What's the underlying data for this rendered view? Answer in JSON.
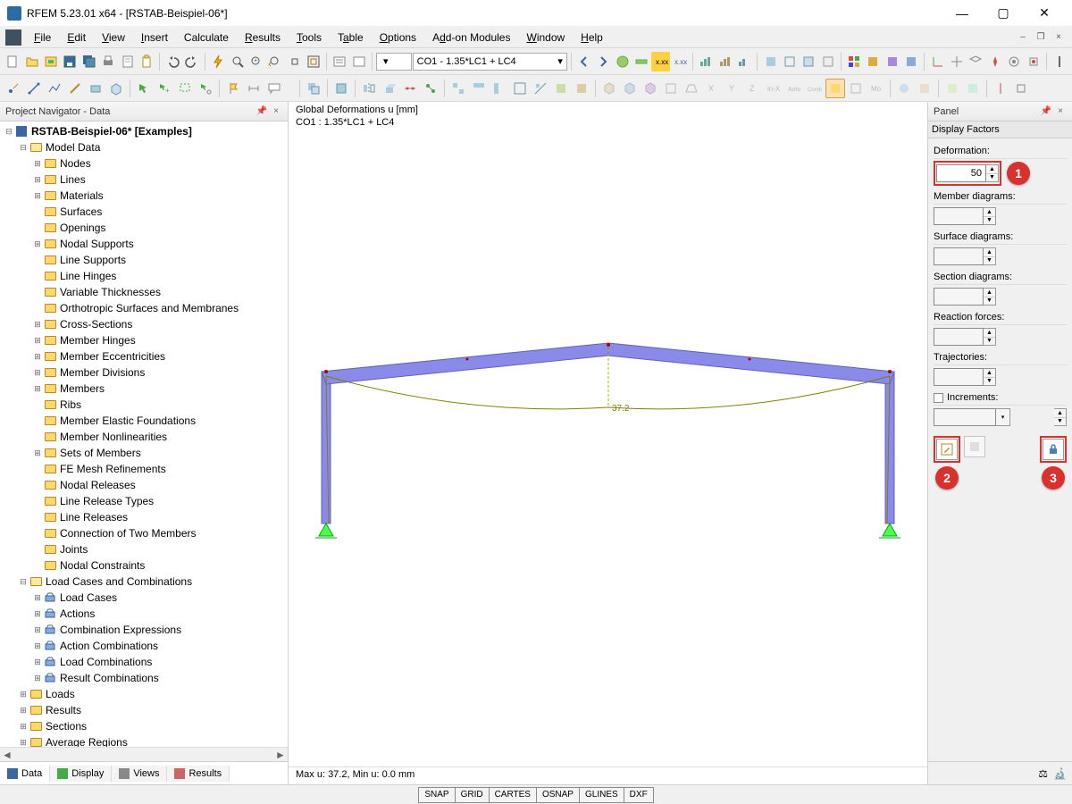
{
  "window": {
    "title": "RFEM 5.23.01 x64 - [RSTAB-Beispiel-06*]",
    "min": "—",
    "max": "▢",
    "close": "✕",
    "sub_min": "–",
    "sub_max": "❐",
    "sub_close": "×"
  },
  "menu": [
    "File",
    "Edit",
    "View",
    "Insert",
    "Calculate",
    "Results",
    "Tools",
    "Table",
    "Options",
    "Add-on Modules",
    "Window",
    "Help"
  ],
  "load_combo": "CO1 - 1.35*LC1 + LC4",
  "nav_title": "Project Navigator - Data",
  "tree": {
    "root": "RSTAB-Beispiel-06* [Examples]",
    "model_data": "Model Data",
    "model_items": [
      "Nodes",
      "Lines",
      "Materials",
      "Surfaces",
      "Openings",
      "Nodal Supports",
      "Line Supports",
      "Line Hinges",
      "Variable Thicknesses",
      "Orthotropic Surfaces and Membranes",
      "Cross-Sections",
      "Member Hinges",
      "Member Eccentricities",
      "Member Divisions",
      "Members",
      "Ribs",
      "Member Elastic Foundations",
      "Member Nonlinearities",
      "Sets of Members",
      "FE Mesh Refinements",
      "Nodal Releases",
      "Line Release Types",
      "Line Releases",
      "Connection of Two Members",
      "Joints",
      "Nodal Constraints"
    ],
    "lcc": "Load Cases and Combinations",
    "lcc_items": [
      "Load Cases",
      "Actions",
      "Combination Expressions",
      "Action Combinations",
      "Load Combinations",
      "Result Combinations"
    ],
    "tail": [
      "Loads",
      "Results",
      "Sections",
      "Average Regions"
    ]
  },
  "nav_tabs": [
    "Data",
    "Display",
    "Views",
    "Results"
  ],
  "viewport": {
    "title_line1": "Global Deformations u [mm]",
    "title_line2": "CO1 : 1.35*LC1 + LC4",
    "value_label": "37.2",
    "footer": "Max u: 37.2, Min u: 0.0 mm"
  },
  "panel": {
    "title": "Panel",
    "section_header": "Display Factors",
    "items": {
      "deformation": {
        "label": "Deformation:",
        "value": "50"
      },
      "member": {
        "label": "Member diagrams:",
        "value": ""
      },
      "surface": {
        "label": "Surface diagrams:",
        "value": ""
      },
      "section": {
        "label": "Section diagrams:",
        "value": ""
      },
      "reaction": {
        "label": "Reaction forces:",
        "value": ""
      },
      "traj": {
        "label": "Trajectories:",
        "value": ""
      },
      "incr": {
        "label": "Increments:",
        "value": ""
      }
    },
    "callouts": {
      "c1": "1",
      "c2": "2",
      "c3": "3"
    }
  },
  "status": [
    "SNAP",
    "GRID",
    "CARTES",
    "OSNAP",
    "GLINES",
    "DXF"
  ]
}
